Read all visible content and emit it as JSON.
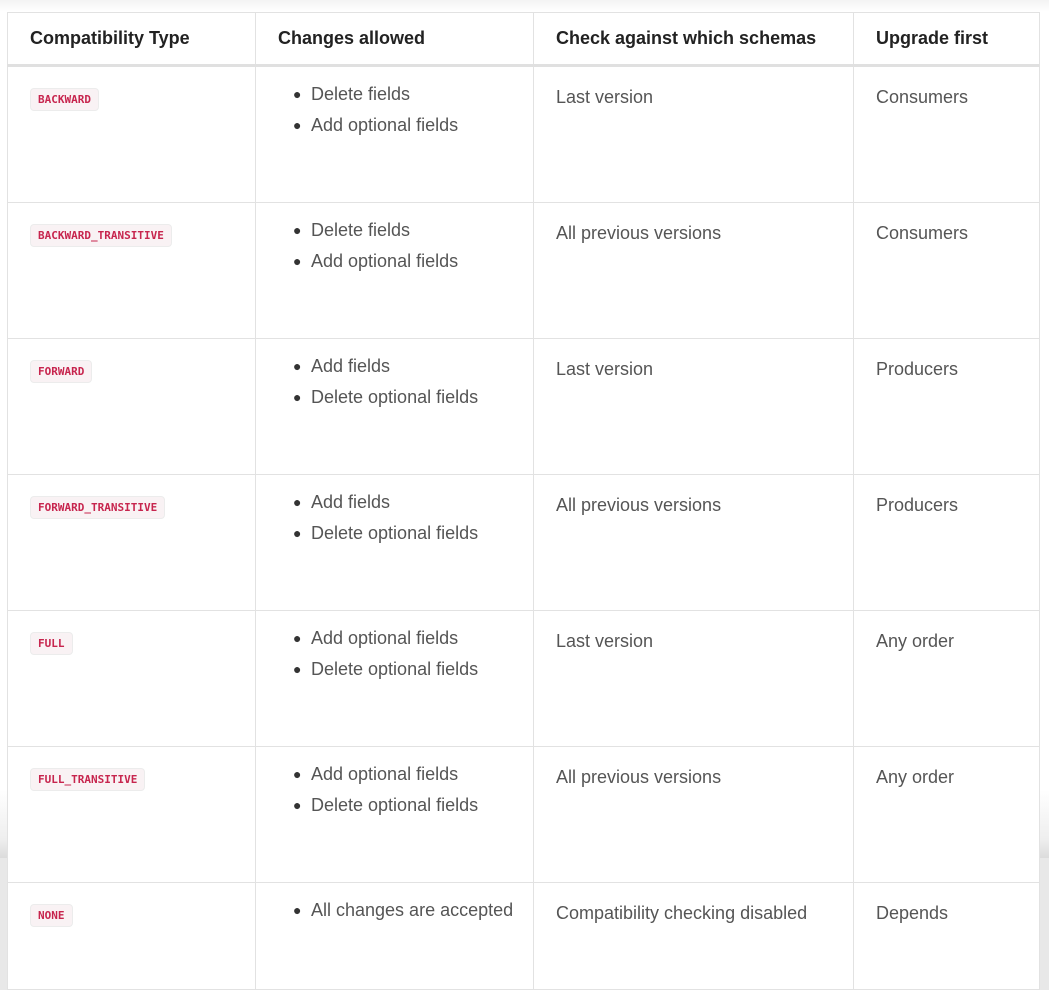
{
  "table": {
    "headers": [
      "Compatibility Type",
      "Changes allowed",
      "Check against which schemas",
      "Upgrade first"
    ],
    "rows": [
      {
        "type": "BACKWARD",
        "changes": [
          "Delete fields",
          "Add optional fields"
        ],
        "check": "Last version",
        "upgrade": "Consumers"
      },
      {
        "type": "BACKWARD_TRANSITIVE",
        "changes": [
          "Delete fields",
          "Add optional fields"
        ],
        "check": "All previous versions",
        "upgrade": "Consumers"
      },
      {
        "type": "FORWARD",
        "changes": [
          "Add fields",
          "Delete optional fields"
        ],
        "check": "Last version",
        "upgrade": "Producers"
      },
      {
        "type": "FORWARD_TRANSITIVE",
        "changes": [
          "Add fields",
          "Delete optional fields"
        ],
        "check": "All previous versions",
        "upgrade": "Producers"
      },
      {
        "type": "FULL",
        "changes": [
          "Add optional fields",
          "Delete optional fields"
        ],
        "check": "Last version",
        "upgrade": "Any order"
      },
      {
        "type": "FULL_TRANSITIVE",
        "changes": [
          "Add optional fields",
          "Delete optional fields"
        ],
        "check": "All previous versions",
        "upgrade": "Any order"
      },
      {
        "type": "NONE",
        "changes": [
          "All changes are accepted"
        ],
        "check": "Compatibility checking disabled",
        "upgrade": "Depends"
      }
    ]
  },
  "colors": {
    "badge_text": "#c7254e",
    "badge_bg": "#f9f2f4",
    "border": "#e2e2e2",
    "header_text": "#222222",
    "cell_text": "#555555"
  },
  "icons": {
    "bullet": "bullet-dot-icon"
  }
}
